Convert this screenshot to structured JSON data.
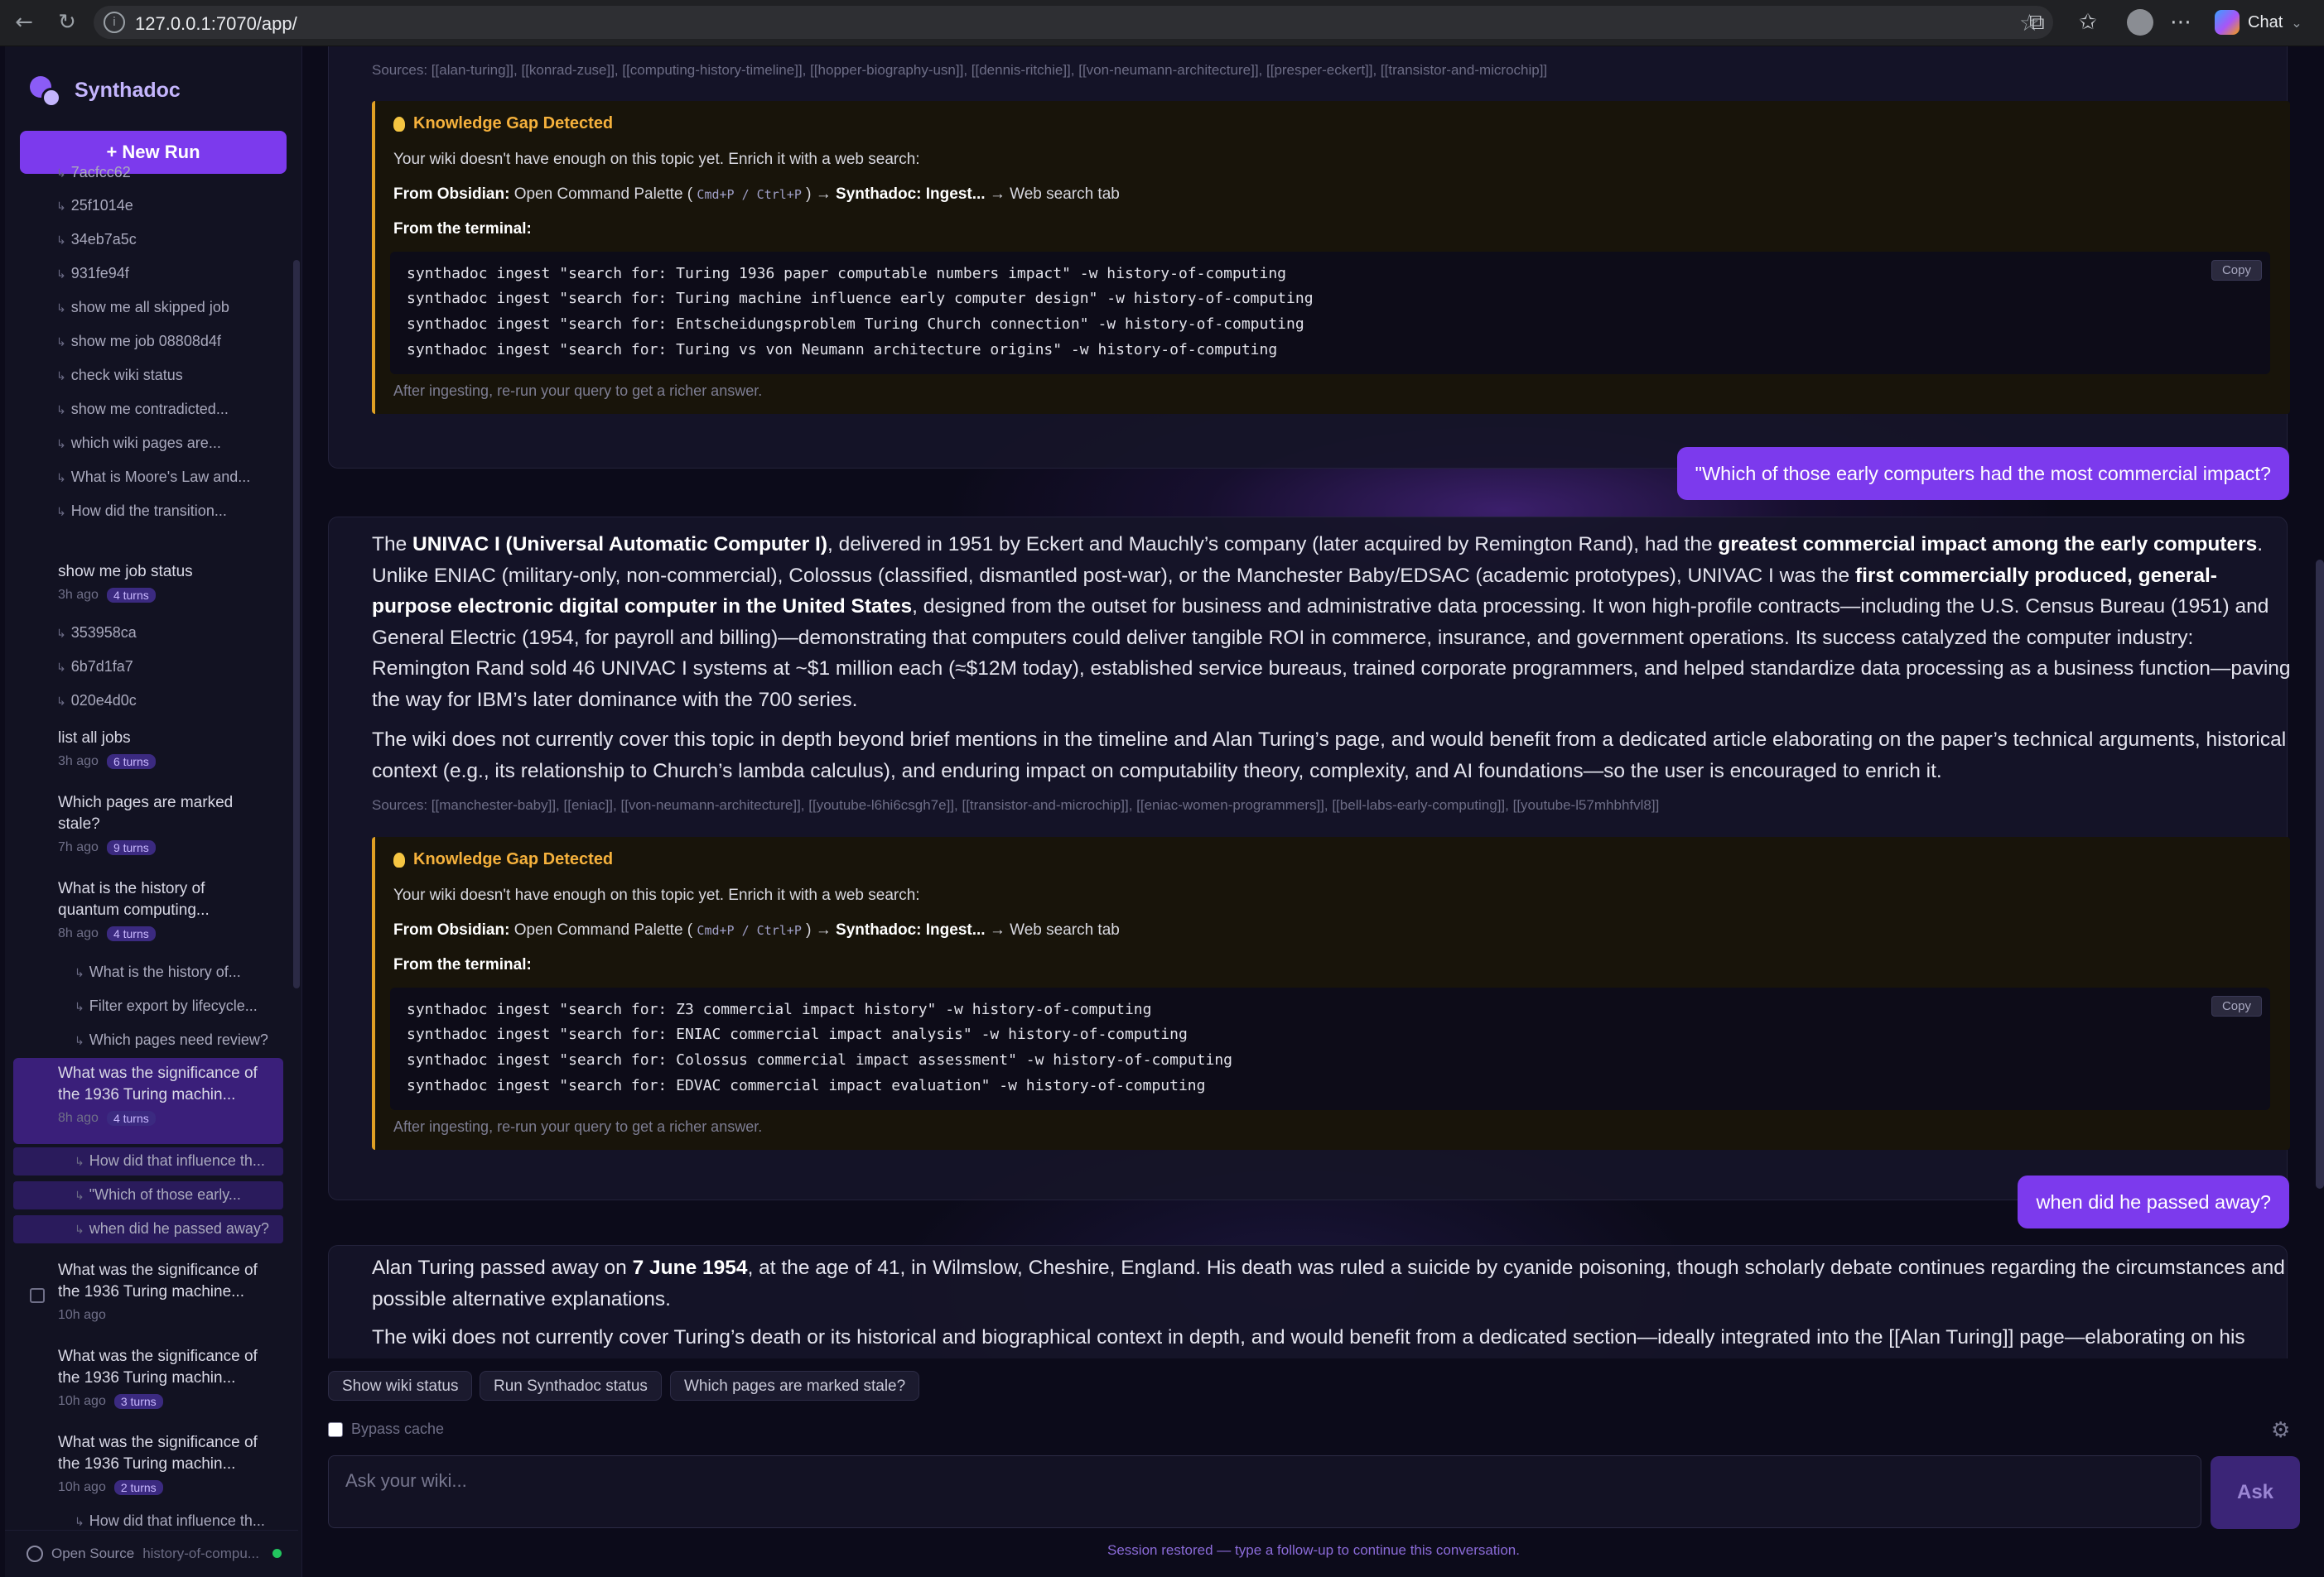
{
  "browser": {
    "url": "127.0.0.1:7070/app/",
    "chat_label": "Chat"
  },
  "sidebar": {
    "brand": "Synthadoc",
    "new_run": "+ New Run",
    "items": [
      {
        "label": "7acfcc62"
      },
      {
        "label": "25f1014e"
      },
      {
        "label": "34eb7a5c"
      },
      {
        "label": "931fe94f"
      },
      {
        "label": "show me all skipped job"
      },
      {
        "label": "show me job 08808d4f"
      },
      {
        "label": "check wiki status"
      },
      {
        "label": "show me contradicted..."
      },
      {
        "label": "which wiki pages are..."
      },
      {
        "label": "What is Moore's Law and..."
      },
      {
        "label": "How did the transition..."
      }
    ],
    "sessions": [
      {
        "title": "show me job status",
        "ago": "3h ago",
        "turns": "4 turns"
      },
      {
        "title": "list all jobs",
        "ago": "3h ago",
        "turns": "6 turns"
      },
      {
        "title": "Which pages are marked stale?",
        "ago": "7h ago",
        "turns": "9 turns"
      },
      {
        "title": "What is the history of quantum computing...",
        "ago": "8h ago",
        "turns": "4 turns"
      },
      {
        "title": "What was the significance of the 1936 Turing machin...",
        "ago": "8h ago",
        "turns": "4 turns"
      },
      {
        "title": "What was the significance of the 1936 Turing machine...",
        "ago": "10h ago",
        "turns": ""
      },
      {
        "title": "What was the significance of the 1936 Turing machin...",
        "ago": "10h ago",
        "turns": "3 turns"
      },
      {
        "title": "What was the significance of the 1936 Turing machin...",
        "ago": "10h ago",
        "turns": "2 turns"
      }
    ],
    "subitems_a": [
      "353958ca",
      "6b7d1fa7",
      "020e4d0c"
    ],
    "subitems_b": [
      "What is the history of...",
      "Filter export by lifecycle...",
      "Which pages need review?"
    ],
    "subitems_c": [
      "How did that influence th...",
      "\"Which of those early...",
      "when did he passed away?"
    ],
    "subitems_d": [
      "How did that influence th..."
    ],
    "footer_label": "Open Source",
    "footer_workspace": "history-of-compu..."
  },
  "conversation": {
    "sources_1": "Sources: [[alan-turing]], [[konrad-zuse]], [[computing-history-timeline]], [[hopper-biography-usn]], [[dennis-ritchie]], [[von-neumann-architecture]], [[presper-eckert]], [[transistor-and-microchip]]",
    "gap_title": "Knowledge Gap Detected",
    "gap_intro": "Your wiki doesn't have enough on this topic yet. Enrich it with a web search:",
    "gap_obsidian_label": "From Obsidian:",
    "gap_obsidian_text1": "Open Command Palette (",
    "gap_obsidian_kbd": "Cmd+P / Ctrl+P",
    "gap_obsidian_text2": ") →",
    "gap_obsidian_bold": "Synthadoc: Ingest...",
    "gap_obsidian_text3": "→ Web search tab",
    "gap_terminal_label": "From the terminal:",
    "gap_after": "After ingesting, re-run your query to get a richer answer.",
    "copy_label": "Copy",
    "gap1_cmds": [
      "synthadoc ingest \"search for: Turing 1936 paper computable numbers impact\" -w history-of-computing",
      "synthadoc ingest \"search for: Turing machine influence early computer design\" -w history-of-computing",
      "synthadoc ingest \"search for: Entscheidungsproblem Turing Church connection\" -w history-of-computing",
      "synthadoc ingest \"search for: Turing vs von Neumann architecture origins\" -w history-of-computing"
    ],
    "user_q1": "\"Which of those early computers had the most commercial impact?",
    "answer2_p1_a": "The ",
    "answer2_p1_b1": "UNIVAC I (Universal Automatic Computer I)",
    "answer2_p1_c": ", delivered in 1951 by Eckert and Mauchly’s company (later acquired by Remington Rand), had the ",
    "answer2_p1_b2": "greatest commercial impact among the early computers",
    "answer2_p1_d": ". Unlike ENIAC (military-only, non-commercial), Colossus (classified, dismantled post-war), or the Manchester Baby/EDSAC (academic prototypes), UNIVAC I was the ",
    "answer2_p1_b3": "first commercially produced, general-purpose electronic digital computer in the United States",
    "answer2_p1_e": ", designed from the outset for business and administrative data processing. It won high-profile contracts—including the U.S. Census Bureau (1951) and General Electric (1954, for payroll and billing)—demonstrating that computers could deliver tangible ROI in commerce, insurance, and government operations. Its success catalyzed the computer industry: Remington Rand sold 46 UNIVAC I systems at ~$1 million each (≈$12M today), established service bureaus, trained corporate programmers, and helped standardize data processing as a business function—paving the way for IBM’s later dominance with the 700 series.",
    "answer2_p2": "The wiki does not currently cover this topic in depth beyond brief mentions in the timeline and Alan Turing’s page, and would benefit from a dedicated article elaborating on the paper’s technical arguments, historical context (e.g., its relationship to Church’s lambda calculus), and enduring impact on computability theory, complexity, and AI foundations—so the user is encouraged to enrich it.",
    "sources_2": "Sources: [[manchester-baby]], [[eniac]], [[von-neumann-architecture]], [[youtube-l6hi6csgh7e]], [[transistor-and-microchip]], [[eniac-women-programmers]], [[bell-labs-early-computing]], [[youtube-l57mhbhfvl8]]",
    "gap2_cmds": [
      "synthadoc ingest \"search for: Z3 commercial impact history\" -w history-of-computing",
      "synthadoc ingest \"search for: ENIAC commercial impact analysis\" -w history-of-computing",
      "synthadoc ingest \"search for: Colossus commercial impact assessment\" -w history-of-computing",
      "synthadoc ingest \"search for: EDVAC commercial impact evaluation\" -w history-of-computing"
    ],
    "user_q2": "when did he passed away?",
    "answer3_p1_a": "Alan Turing passed away on ",
    "answer3_p1_b": "7 June 1954",
    "answer3_p1_c": ", at the age of 41, in Wilmslow, Cheshire, England. His death was ruled a suicide by cyanide poisoning, though scholarly debate continues regarding the circumstances and possible alternative explanations.",
    "answer3_p2": "The wiki does not currently cover Turing’s death or its historical and biographical context in depth, and would benefit from a dedicated section—ideally integrated into the [[Alan Turing]] page—elaborating on his post-"
  },
  "composer": {
    "chips": [
      "Show wiki status",
      "Run Synthadoc status",
      "Which pages are marked stale?"
    ],
    "bypass_label": "Bypass cache",
    "placeholder": "Ask your wiki...",
    "ask_label": "Ask",
    "status": "Session restored — type a follow-up to continue this conversation."
  },
  "colors": {
    "accent": "#7c3aed",
    "gap_border": "#e0a024",
    "background": "#0c0b1a"
  }
}
